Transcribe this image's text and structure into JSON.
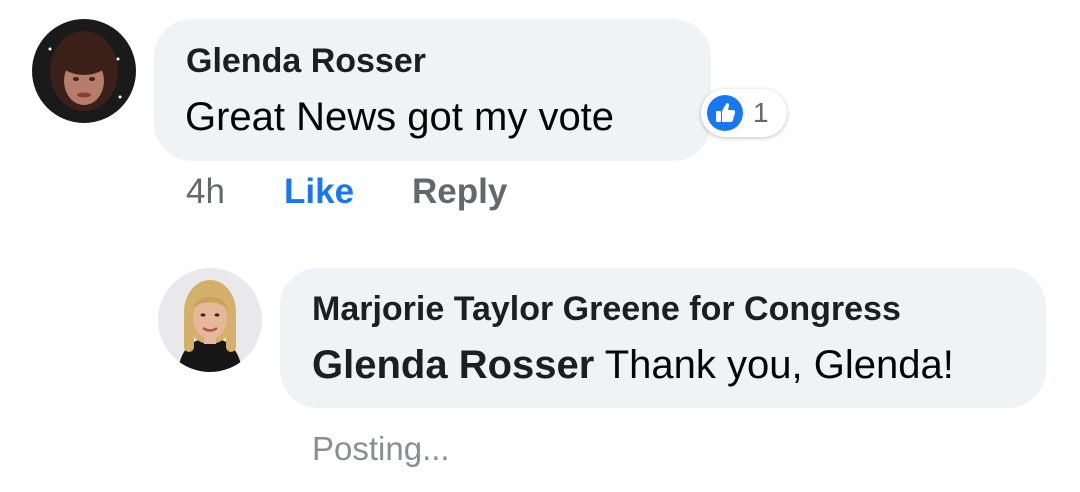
{
  "comment": {
    "author": "Glenda Rosser",
    "text": "Great News got my vote",
    "reaction_count": "1",
    "time": "4h",
    "like_label": "Like",
    "reply_label": "Reply"
  },
  "reply": {
    "author": "Marjorie Taylor Greene for Congress",
    "mention": "Glenda Rosser",
    "text": " Thank you, Glenda!",
    "status": "Posting..."
  },
  "colors": {
    "bubble_bg": "#f0f2f5",
    "like_blue": "#1877f2",
    "secondary_text": "#65676b"
  },
  "icons": {
    "reaction": "like-thumbs-up-icon"
  }
}
